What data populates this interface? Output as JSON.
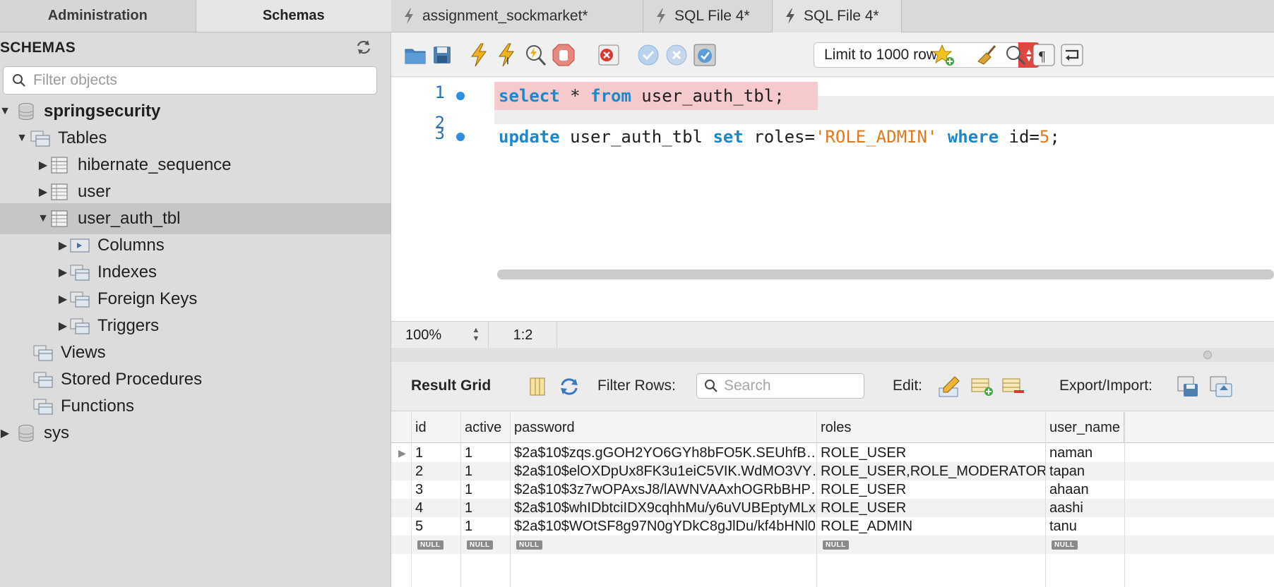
{
  "left_tabs": [
    "Administration",
    "Schemas"
  ],
  "schemas_title": "SCHEMAS",
  "filter_placeholder": "Filter objects",
  "tree": [
    {
      "label": "springsecurity"
    },
    {
      "label": "Tables"
    },
    {
      "label": "hibernate_sequence"
    },
    {
      "label": "user"
    },
    {
      "label": "user_auth_tbl"
    },
    {
      "label": "Columns"
    },
    {
      "label": "Indexes"
    },
    {
      "label": "Foreign Keys"
    },
    {
      "label": "Triggers"
    },
    {
      "label": "Views"
    },
    {
      "label": "Stored Procedures"
    },
    {
      "label": "Functions"
    },
    {
      "label": "sys"
    }
  ],
  "file_tabs": [
    "assignment_sockmarket*",
    "SQL File 4*",
    "SQL File 4*"
  ],
  "limit_label": "Limit to 1000 rows",
  "editor": {
    "line_numbers": [
      "1",
      "2",
      "3"
    ],
    "line1": {
      "kw1": "select",
      "t1": " * ",
      "kw2": "from",
      "t2": " user_auth_tbl;"
    },
    "line3": {
      "kw1": "update",
      "t1": " user_auth_tbl ",
      "kw2": "set",
      "t2": " roles=",
      "str": "'ROLE_ADMIN'",
      "t3": " ",
      "kw3": "where",
      "t4": " id=",
      "num": "5",
      "t5": ";"
    }
  },
  "status": {
    "zoom": "100%",
    "cursor": "1:2"
  },
  "result_bar": {
    "title": "Result Grid",
    "filter_label": "Filter Rows:",
    "search_placeholder": "Search",
    "edit_label": "Edit:",
    "export_label": "Export/Import:"
  },
  "grid": {
    "columns": [
      "id",
      "active",
      "password",
      "roles",
      "user_name"
    ],
    "rows": [
      [
        "1",
        "1",
        "$2a$10$zqs.gGOH2YO6GYh8bFO5K.SEUhfB…",
        "ROLE_USER",
        "naman"
      ],
      [
        "2",
        "1",
        "$2a$10$elOXDpUx8FK3u1eiC5VIK.WdMO3VY…",
        "ROLE_USER,ROLE_MODERATOR",
        "tapan"
      ],
      [
        "3",
        "1",
        "$2a$10$3z7wOPAxsJ8/lAWNVAAxhOGRbBHP…",
        "ROLE_USER",
        "ahaan"
      ],
      [
        "4",
        "1",
        "$2a$10$whIDbtciIDX9cqhhMu/y6uVUBEptyMLx…",
        "ROLE_USER",
        "aashi"
      ],
      [
        "5",
        "1",
        "$2a$10$WOtSF8g97N0gYDkC8gJlDu/kf4bHNl0…",
        "ROLE_ADMIN",
        "tanu"
      ]
    ],
    "null_label": "NULL"
  }
}
